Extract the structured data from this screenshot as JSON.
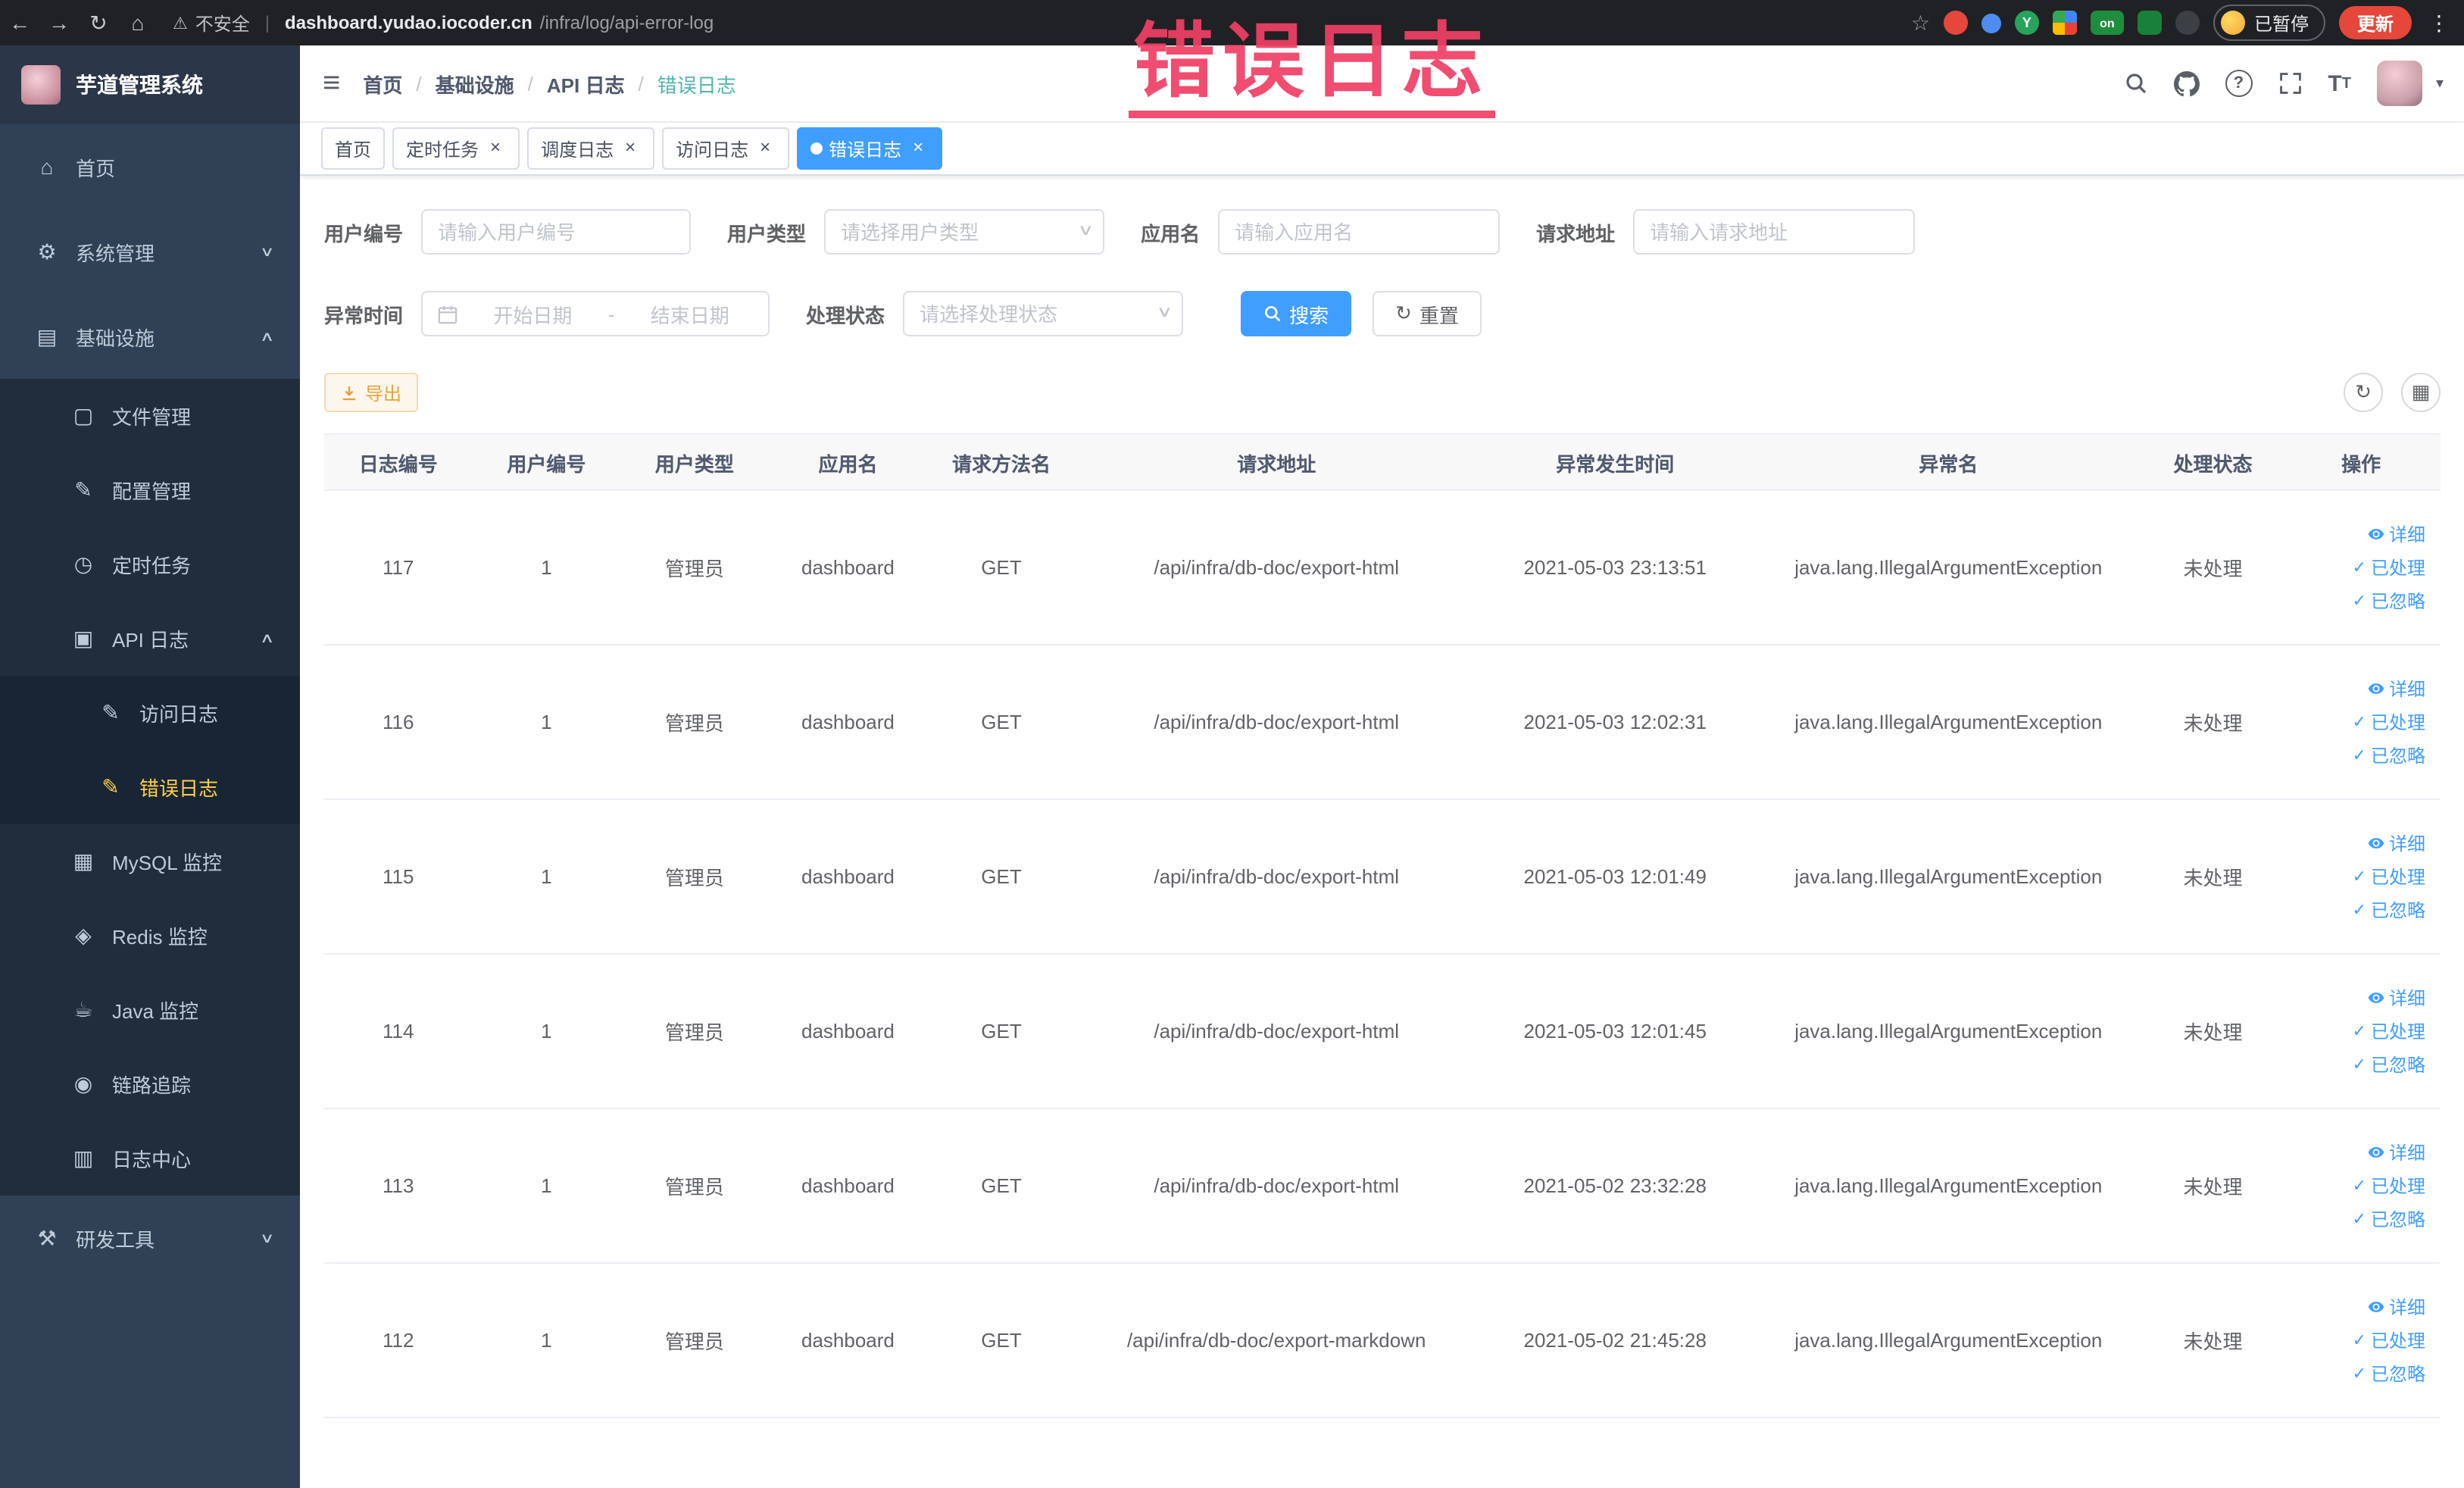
{
  "browser": {
    "security_label": "不安全",
    "url_domain": "dashboard.yudao.iocoder.cn",
    "url_path": "/infra/log/api-error-log",
    "ext_on_label": "on",
    "profile_label": "已暂停",
    "update_label": "更新"
  },
  "annotation": {
    "text": "错误日志"
  },
  "sidebar": {
    "logo_title": "芋道管理系统",
    "items": [
      {
        "label": "首页"
      },
      {
        "label": "系统管理"
      },
      {
        "label": "基础设施"
      },
      {
        "label": "文件管理"
      },
      {
        "label": "配置管理"
      },
      {
        "label": "定时任务"
      },
      {
        "label": "API 日志"
      },
      {
        "label": "访问日志"
      },
      {
        "label": "错误日志"
      },
      {
        "label": "MySQL 监控"
      },
      {
        "label": "Redis 监控"
      },
      {
        "label": "Java 监控"
      },
      {
        "label": "链路追踪"
      },
      {
        "label": "日志中心"
      },
      {
        "label": "研发工具"
      }
    ]
  },
  "breadcrumb": {
    "separator": "/",
    "items": [
      "首页",
      "基础设施",
      "API 日志",
      "错误日志"
    ]
  },
  "tabs": [
    {
      "label": "首页"
    },
    {
      "label": "定时任务"
    },
    {
      "label": "调度日志"
    },
    {
      "label": "访问日志"
    },
    {
      "label": "错误日志"
    }
  ],
  "filters": {
    "user_id": {
      "label": "用户编号",
      "placeholder": "请输入用户编号"
    },
    "user_type": {
      "label": "用户类型",
      "placeholder": "请选择用户类型"
    },
    "app_name": {
      "label": "应用名",
      "placeholder": "请输入应用名"
    },
    "request_url": {
      "label": "请求地址",
      "placeholder": "请输入请求地址"
    },
    "exception_time": {
      "label": "异常时间",
      "start_placeholder": "开始日期",
      "separator": "-",
      "end_placeholder": "结束日期"
    },
    "process_status": {
      "label": "处理状态",
      "placeholder": "请选择处理状态"
    },
    "search_label": "搜索",
    "reset_label": "重置"
  },
  "toolbar": {
    "export_label": "导出"
  },
  "table": {
    "columns": [
      "日志编号",
      "用户编号",
      "用户类型",
      "应用名",
      "请求方法名",
      "请求地址",
      "异常发生时间",
      "异常名",
      "处理状态",
      "操作"
    ],
    "actions": {
      "detail": "详细",
      "processed": "已处理",
      "ignored": "已忽略"
    },
    "rows": [
      {
        "id": "117",
        "user_id": "1",
        "user_type": "管理员",
        "app": "dashboard",
        "method": "GET",
        "url": "/api/infra/db-doc/export-html",
        "time": "2021-05-03 23:13:51",
        "exception": "java.lang.IllegalArgumentException",
        "status": "未处理"
      },
      {
        "id": "116",
        "user_id": "1",
        "user_type": "管理员",
        "app": "dashboard",
        "method": "GET",
        "url": "/api/infra/db-doc/export-html",
        "time": "2021-05-03 12:02:31",
        "exception": "java.lang.IllegalArgumentException",
        "status": "未处理"
      },
      {
        "id": "115",
        "user_id": "1",
        "user_type": "管理员",
        "app": "dashboard",
        "method": "GET",
        "url": "/api/infra/db-doc/export-html",
        "time": "2021-05-03 12:01:49",
        "exception": "java.lang.IllegalArgumentException",
        "status": "未处理"
      },
      {
        "id": "114",
        "user_id": "1",
        "user_type": "管理员",
        "app": "dashboard",
        "method": "GET",
        "url": "/api/infra/db-doc/export-html",
        "time": "2021-05-03 12:01:45",
        "exception": "java.lang.IllegalArgumentException",
        "status": "未处理"
      },
      {
        "id": "113",
        "user_id": "1",
        "user_type": "管理员",
        "app": "dashboard",
        "method": "GET",
        "url": "/api/infra/db-doc/export-html",
        "time": "2021-05-02 23:32:28",
        "exception": "java.lang.IllegalArgumentException",
        "status": "未处理"
      },
      {
        "id": "112",
        "user_id": "1",
        "user_type": "管理员",
        "app": "dashboard",
        "method": "GET",
        "url": "/api/infra/db-doc/export-markdown",
        "time": "2021-05-02 21:45:28",
        "exception": "java.lang.IllegalArgumentException",
        "status": "未处理"
      }
    ]
  }
}
